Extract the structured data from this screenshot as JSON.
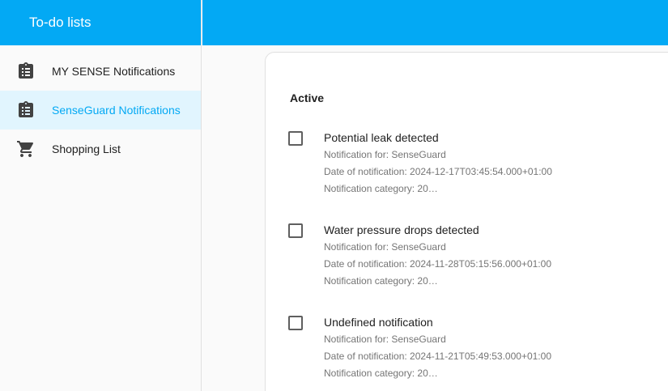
{
  "sidebar": {
    "title": "To-do lists",
    "items": [
      {
        "label": "MY SENSE Notifications",
        "icon": "clipboard-list-icon"
      },
      {
        "label": "SenseGuard Notifications",
        "icon": "clipboard-list-icon",
        "selected": true
      },
      {
        "label": "Shopping List",
        "icon": "cart-icon"
      }
    ]
  },
  "main": {
    "section_title": "Active",
    "items": [
      {
        "title": "Potential leak detected",
        "for": "Notification for: SenseGuard",
        "date": "Date of notification: 2024-12-17T03:45:54.000+01:00",
        "category": "Notification category: 20…"
      },
      {
        "title": "Water pressure drops detected",
        "for": "Notification for: SenseGuard",
        "date": "Date of notification: 2024-11-28T05:15:56.000+01:00",
        "category": "Notification category: 20…"
      },
      {
        "title": "Undefined notification",
        "for": "Notification for: SenseGuard",
        "date": "Date of notification: 2024-11-21T05:49:53.000+01:00",
        "category": "Notification category: 20…"
      }
    ]
  },
  "colors": {
    "primary": "#03a9f4",
    "selected_bg": "#e1f5fe"
  }
}
